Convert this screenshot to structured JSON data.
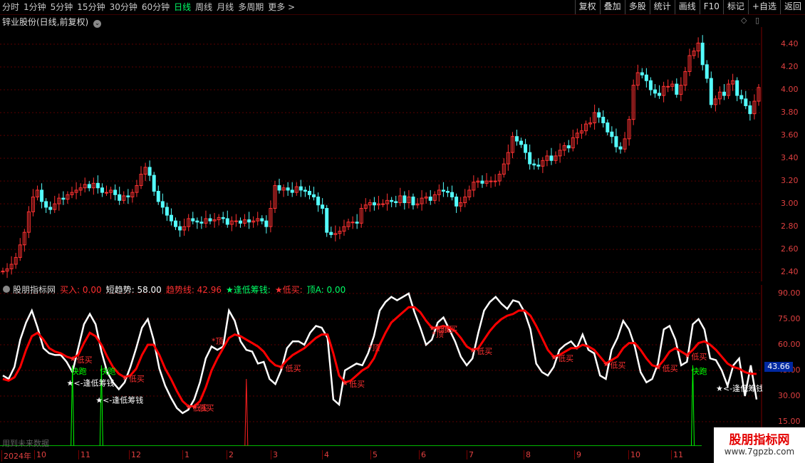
{
  "toolbar": {
    "periods": [
      "分时",
      "1分钟",
      "5分钟",
      "15分钟",
      "30分钟",
      "60分钟",
      "日线",
      "周线",
      "月线",
      "多周期",
      "更多 >"
    ],
    "active_period": "日线",
    "tools": [
      "复权",
      "叠加",
      "多股",
      "统计",
      "画线",
      "F10",
      "标记",
      "+自选",
      "返回"
    ]
  },
  "stock": {
    "title": "锌业股份(日线,前复权)"
  },
  "price_axis": {
    "ticks": [
      "4.40",
      "4.20",
      "4.00",
      "3.80",
      "3.60",
      "3.40",
      "3.20",
      "3.00",
      "2.80",
      "2.60",
      "2.40"
    ],
    "min": 2.32,
    "max": 4.55
  },
  "indicator": {
    "name": "股朋指标网",
    "buy": "买入: 0.00",
    "short_trend": "短趋势: 58.00",
    "trend_line": "趋势线: 42.96",
    "low_chip": "★逢低筹钱:",
    "low_buy": "★低买:",
    "top_a": "顶A: 0.00",
    "axis_ticks": [
      "90.00",
      "75.00",
      "60.00",
      "45.00",
      "30.00",
      "15.00"
    ],
    "current_value": "43.66",
    "future_note": "用到未来数据"
  },
  "annotations": {
    "low_buy": "低买",
    "top": "顶",
    "chip": "<-逢低筹钱",
    "surge": "快跑"
  },
  "date_axis": {
    "labels": [
      "2024年",
      "10",
      "11",
      "12",
      "1",
      "2",
      "3",
      "4",
      "5",
      "6",
      "7",
      "8",
      "9",
      "10",
      "11"
    ]
  },
  "watermark": {
    "title": "股朋指标网",
    "url": "www.7gpzb.com"
  },
  "colors": {
    "up": "#ff3232",
    "down": "#54fcfc",
    "trend": "#ff0000",
    "short": "#ffffff",
    "grid": "#5a0000",
    "axis": "#e04040"
  },
  "chart_data": {
    "type": "candlestick",
    "price_ylim": [
      2.32,
      4.55
    ],
    "indicator_ylim": [
      0,
      95
    ],
    "close": [
      2.41,
      2.43,
      2.47,
      2.53,
      2.64,
      2.75,
      2.93,
      3.06,
      3.12,
      3.02,
      2.97,
      2.95,
      3.0,
      3.05,
      3.04,
      3.08,
      3.1,
      3.12,
      3.14,
      3.17,
      3.14,
      3.18,
      3.14,
      3.1,
      3.1,
      3.12,
      3.08,
      3.03,
      3.07,
      3.06,
      3.1,
      3.16,
      3.26,
      3.32,
      3.25,
      3.11,
      3.02,
      2.97,
      2.9,
      2.85,
      2.8,
      2.77,
      2.8,
      2.87,
      2.85,
      2.84,
      2.83,
      2.87,
      2.85,
      2.86,
      2.88,
      2.87,
      2.82,
      2.85,
      2.85,
      2.83,
      2.86,
      2.84,
      2.85,
      2.87,
      2.85,
      2.8,
      2.96,
      3.16,
      3.12,
      3.14,
      3.12,
      3.1,
      3.15,
      3.12,
      3.11,
      3.08,
      3.06,
      2.99,
      2.96,
      2.75,
      2.73,
      2.74,
      2.76,
      2.8,
      2.84,
      2.84,
      2.83,
      2.96,
      2.99,
      3.01,
      2.99,
      3.0,
      3.0,
      3.03,
      3.02,
      3.01,
      3.07,
      3.01,
      3.06,
      2.99,
      3.0,
      3.05,
      3.06,
      3.03,
      3.08,
      3.12,
      3.11,
      3.1,
      3.06,
      2.98,
      3.01,
      3.06,
      3.12,
      3.19,
      3.2,
      3.18,
      3.2,
      3.2,
      3.2,
      3.26,
      3.35,
      3.45,
      3.59,
      3.55,
      3.52,
      3.45,
      3.35,
      3.34,
      3.33,
      3.38,
      3.42,
      3.38,
      3.42,
      3.47,
      3.51,
      3.49,
      3.58,
      3.62,
      3.64,
      3.7,
      3.71,
      3.8,
      3.76,
      3.71,
      3.63,
      3.59,
      3.5,
      3.48,
      3.57,
      3.74,
      4.04,
      4.15,
      4.13,
      4.08,
      4.0,
      3.97,
      3.95,
      4.03,
      4.03,
      4.05,
      3.96,
      4.04,
      4.16,
      4.3,
      4.34,
      4.41,
      4.22,
      4.1,
      3.87,
      3.92,
      3.98,
      3.95,
      4.05,
      4.08,
      3.95,
      3.92,
      3.86,
      3.79,
      3.9,
      4.02
    ],
    "short_trend": [
      42,
      40,
      47,
      63,
      73,
      80,
      70,
      58,
      55,
      54,
      54,
      50,
      44,
      58,
      72,
      78,
      72,
      56,
      44,
      38,
      34,
      38,
      47,
      58,
      70,
      75,
      63,
      46,
      36,
      29,
      23,
      20,
      22,
      28,
      38,
      52,
      59,
      57,
      59,
      80,
      74,
      62,
      57,
      56,
      49,
      50,
      40,
      37,
      45,
      58,
      62,
      62,
      60,
      67,
      71,
      70,
      64,
      28,
      25,
      45,
      47,
      49,
      48,
      55,
      65,
      80,
      85,
      88,
      86,
      88,
      90,
      79,
      70,
      60,
      63,
      73,
      76,
      69,
      62,
      53,
      48,
      52,
      67,
      80,
      85,
      88,
      84,
      81,
      86,
      85,
      79,
      69,
      49,
      44,
      42,
      47,
      57,
      60,
      62,
      58,
      66,
      57,
      55,
      42,
      40,
      57,
      64,
      74,
      69,
      59,
      44,
      38,
      40,
      49,
      69,
      71,
      63,
      48,
      50,
      72,
      75,
      69,
      52,
      51,
      45,
      36,
      48,
      52,
      30,
      48,
      28
    ],
    "trend": [
      40,
      39,
      41,
      47,
      57,
      65,
      67,
      63,
      58,
      56,
      55,
      53,
      52,
      54,
      61,
      67,
      65,
      60,
      53,
      47,
      43,
      41,
      42,
      46,
      54,
      60,
      60,
      54,
      46,
      40,
      33,
      27,
      24,
      24,
      27,
      35,
      45,
      52,
      58,
      64,
      66,
      65,
      63,
      61,
      59,
      56,
      51,
      48,
      47,
      51,
      54,
      56,
      58,
      61,
      64,
      66,
      66,
      55,
      42,
      38,
      39,
      42,
      45,
      47,
      52,
      60,
      67,
      73,
      76,
      79,
      82,
      82,
      79,
      74,
      70,
      70,
      71,
      70,
      68,
      64,
      59,
      57,
      58,
      63,
      68,
      72,
      75,
      77,
      78,
      80,
      80,
      77,
      71,
      64,
      57,
      53,
      54,
      56,
      58,
      58,
      60,
      59,
      57,
      53,
      49,
      51,
      53,
      58,
      61,
      61,
      57,
      52,
      48,
      47,
      51,
      56,
      58,
      56,
      54,
      57,
      61,
      62,
      60,
      57,
      53,
      49,
      47,
      46,
      44,
      43,
      42.96
    ],
    "surge_spikes": [
      12,
      17,
      119
    ],
    "top_spikes": [
      42
    ]
  }
}
